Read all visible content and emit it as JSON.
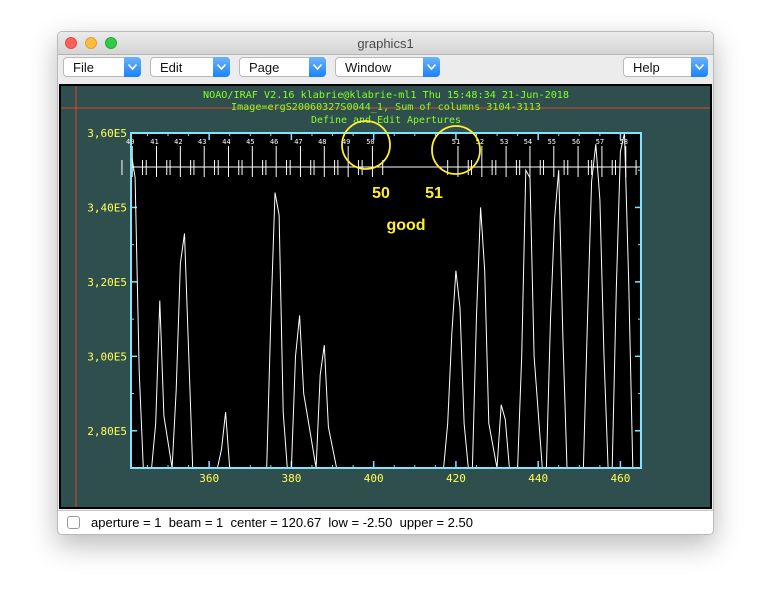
{
  "window": {
    "title": "graphics1"
  },
  "menubar": {
    "items": [
      {
        "label": "File",
        "name": "file"
      },
      {
        "label": "Edit",
        "name": "edit"
      },
      {
        "label": "Page",
        "name": "page"
      },
      {
        "label": "Window",
        "name": "window"
      },
      {
        "label": "Help",
        "name": "help"
      }
    ]
  },
  "plot": {
    "header_lines": [
      "NOAO/IRAF V2.16 klabrie@klabrie-ml1 Thu 15:48:34 21-Jun-2018",
      "Image=ergS20060327S0044_1, Sum of columns 3104-3113",
      "Define and Edit Apertures"
    ],
    "annotations": {
      "label_50": "50",
      "label_51": "51",
      "good": "good"
    },
    "colors": {
      "background": "#2f4f4f",
      "frame": "#7fe5ff",
      "text": "#ffff55",
      "header": "#88ff22",
      "spectrum": "#ffffff",
      "annotation": "#ffee33",
      "crosshair": "#d24a2a"
    }
  },
  "chart_data": {
    "type": "line",
    "title": "",
    "xlabel": "",
    "ylabel": "",
    "xlim": [
      341,
      465
    ],
    "ylim": [
      270000.0,
      360000.0
    ],
    "x_ticks": [
      360,
      380,
      400,
      420,
      440,
      460
    ],
    "y_ticks": [
      280000.0,
      300000.0,
      320000.0,
      340000.0,
      360000.0
    ],
    "x_tick_labels": [
      "360",
      "380",
      "400",
      "420",
      "440",
      "460"
    ],
    "y_tick_labels": [
      "2,80E5",
      "3,00E5",
      "3,20E5",
      "3,40E5",
      "3,60E5"
    ],
    "aperture_labels": [
      "40",
      "41",
      "42",
      "43",
      "44",
      "45",
      "46",
      "47",
      "48",
      "49",
      "50",
      "51",
      "52",
      "53",
      "54",
      "55",
      "56",
      "57",
      "58"
    ],
    "aperture_centers": [
      341.3,
      347.2,
      353.0,
      358.8,
      364.7,
      370.5,
      376.3,
      382.2,
      388.0,
      393.8,
      399.7,
      420.5,
      426.3,
      432.2,
      438.0,
      443.8,
      449.7,
      455.5,
      461.3
    ],
    "series": [
      {
        "x": [
          341,
          342,
          343,
          344,
          346,
          347,
          348,
          349,
          351,
          352,
          353,
          354,
          356,
          362,
          363,
          364,
          365,
          366,
          374,
          375,
          376,
          377,
          378,
          379,
          380,
          381,
          382,
          383,
          386,
          387,
          388,
          389,
          391,
          417,
          418,
          419,
          420,
          421,
          422,
          423,
          424,
          425,
          426,
          427,
          428,
          430,
          431,
          432,
          433,
          435,
          436,
          437,
          438,
          439,
          441,
          442,
          443,
          444,
          445,
          446,
          447,
          448,
          451,
          452,
          453,
          454,
          455,
          456,
          457,
          458,
          459,
          460,
          461,
          462,
          463,
          464,
          465
        ],
        "y": [
          355000,
          348000,
          296000,
          270000,
          270000,
          282000,
          315000,
          284000,
          270000,
          291000,
          325000,
          333000,
          270000,
          270000,
          275000,
          285000,
          270000,
          270000,
          270000,
          310000,
          344000,
          338000,
          285000,
          270000,
          270000,
          300000,
          311000,
          290000,
          270000,
          295000,
          303000,
          281000,
          270000,
          270000,
          282000,
          306000,
          323000,
          313000,
          282000,
          270000,
          270000,
          311000,
          340000,
          323000,
          282000,
          270000,
          287000,
          283000,
          270000,
          270000,
          300000,
          350000,
          348000,
          300000,
          270000,
          270000,
          310000,
          337000,
          350000,
          305000,
          270000,
          270000,
          270000,
          310000,
          347000,
          357000,
          342000,
          300000,
          270000,
          270000,
          318000,
          355000,
          360000,
          320000,
          270000,
          270000,
          270000
        ]
      }
    ],
    "grid": false
  },
  "status": {
    "text": "aperture = 1  beam = 1  center = 120.67  low = -2.50  upper = 2.50"
  }
}
